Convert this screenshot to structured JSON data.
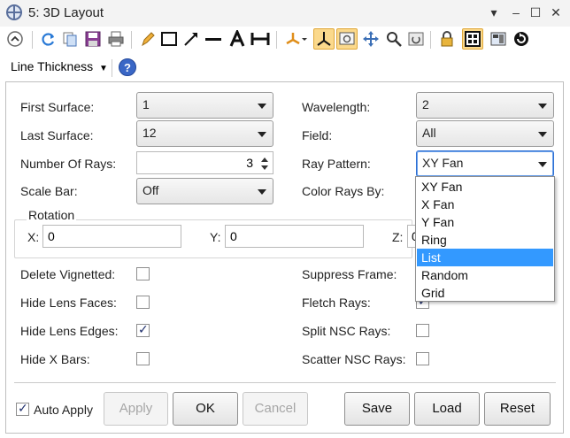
{
  "window": {
    "title": "5: 3D Layout",
    "controls": {
      "dropdown": "▾",
      "minimize": "–",
      "maximize": "☐",
      "close": "✕"
    }
  },
  "toolbar": {
    "icons": [
      "back-circle-icon",
      "refresh-icon",
      "copy-icon",
      "save-icon",
      "print-icon",
      "pencil-icon",
      "rectangle-icon",
      "arrow-icon",
      "line-icon",
      "text-icon",
      "dimension-icon",
      "rotate-3d-icon",
      "axis-icon",
      "settings-window-icon",
      "move-icon",
      "zoom-icon",
      "reset-view-icon",
      "lock-icon",
      "grid-icon",
      "layout-icon",
      "cycle-icon"
    ],
    "line_thickness_label": "Line Thickness"
  },
  "form": {
    "first_surface": {
      "label": "First Surface:",
      "value": "1"
    },
    "last_surface": {
      "label": "Last Surface:",
      "value": "12"
    },
    "number_of_rays": {
      "label": "Number Of Rays:",
      "value": "3"
    },
    "scale_bar": {
      "label": "Scale Bar:",
      "value": "Off"
    },
    "wavelength": {
      "label": "Wavelength:",
      "value": "2"
    },
    "field": {
      "label": "Field:",
      "value": "All"
    },
    "ray_pattern": {
      "label": "Ray Pattern:",
      "value": "XY Fan"
    },
    "color_rays_by": {
      "label": "Color Rays By:"
    },
    "rotation": {
      "title": "Rotation",
      "x": {
        "label": "X:",
        "value": "0"
      },
      "y": {
        "label": "Y:",
        "value": "0"
      },
      "z": {
        "label": "Z:",
        "value": "0"
      }
    },
    "checks_left": [
      {
        "label": "Delete Vignetted:",
        "checked": false
      },
      {
        "label": "Hide Lens Faces:",
        "checked": false
      },
      {
        "label": "Hide Lens Edges:",
        "checked": true
      },
      {
        "label": "Hide X Bars:",
        "checked": false
      }
    ],
    "checks_right": [
      {
        "label": "Suppress Frame:",
        "checked": false
      },
      {
        "label": "Fletch Rays:",
        "checked": true
      },
      {
        "label": "Split NSC Rays:",
        "checked": false
      },
      {
        "label": "Scatter NSC Rays:",
        "checked": false
      }
    ]
  },
  "dropdown": {
    "options": [
      "XY Fan",
      "X Fan",
      "Y Fan",
      "Ring",
      "List",
      "Random",
      "Grid"
    ],
    "highlighted": "List"
  },
  "footer": {
    "auto_apply": {
      "label": "Auto Apply",
      "checked": true
    },
    "apply": "Apply",
    "ok": "OK",
    "cancel": "Cancel",
    "save": "Save",
    "load": "Load",
    "reset": "Reset"
  },
  "colors": {
    "accent": "#3399ff",
    "active_tool": "#fbd98c",
    "help": "#3a67c6"
  }
}
